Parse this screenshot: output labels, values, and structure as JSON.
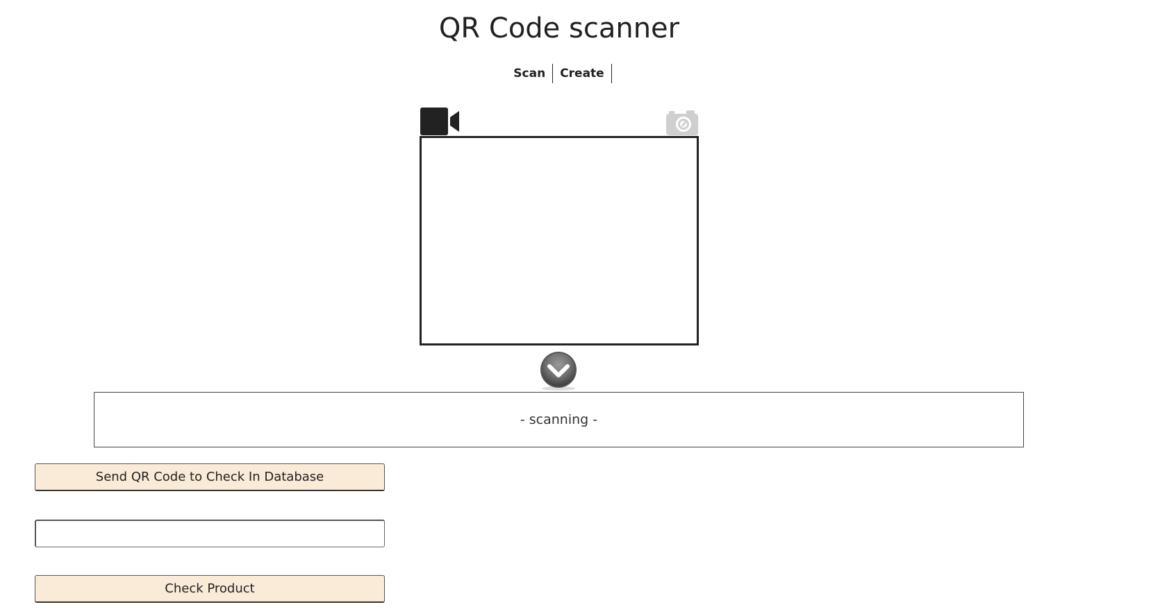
{
  "page": {
    "title": "QR Code scanner"
  },
  "nav": {
    "tabs": [
      {
        "label": "Scan"
      },
      {
        "label": "Create"
      }
    ]
  },
  "scanner": {
    "video_icon": "video-camera-icon",
    "photo_icon": "photo-camera-icon",
    "toggle_icon": "chevron-down-icon"
  },
  "result": {
    "status_text": "- scanning -"
  },
  "actions": {
    "send_label": "Send QR Code to Check In Database",
    "product_input_value": "",
    "product_input_placeholder": "",
    "check_label": "Check Product"
  },
  "colors": {
    "button_bg": "#faebd7",
    "icon_dark": "#222222",
    "icon_light": "#cccccc"
  }
}
